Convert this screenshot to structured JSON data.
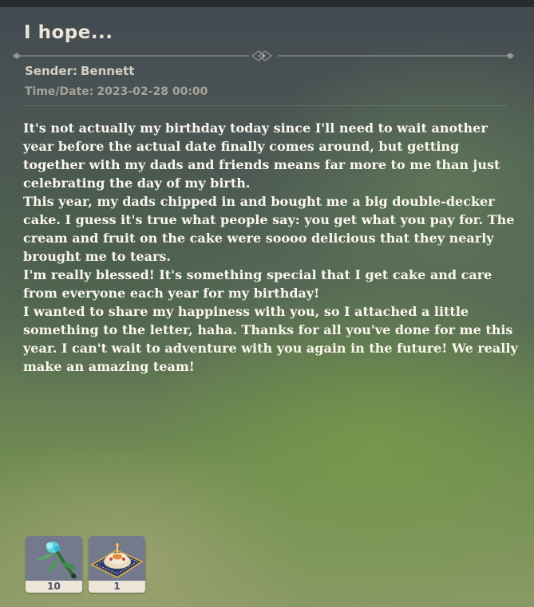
{
  "mail": {
    "title": "I hope...",
    "sender_label": "Sender:",
    "sender_name": "Bennett",
    "time_label": "Time/Date:",
    "time_value": "2023-02-28 00:00",
    "paragraphs": [
      "It's not actually my birthday today since I'll need to wait another year before the actual date finally comes around, but getting together with my dads and friends means far more to me than just celebrating the day of my birth.",
      "This year, my dads chipped in and bought me a big double-decker cake. I guess it's true what people say: you get what you pay for. The cream and fruit on the cake were soooo delicious that they nearly brought me to tears.",
      "I'm really blessed! It's something special that I get cake and care from everyone each year for my birthday!",
      "I wanted to share my happiness with you, so I attached a little something to the letter, haha. Thanks for all you've done for me this year. I can't wait to adventure with you again in the future! We really make an amazing team!"
    ]
  },
  "attachments": [
    {
      "icon": "flower-bouquet-icon",
      "count": "10"
    },
    {
      "icon": "cake-dish-icon",
      "count": "1"
    }
  ]
}
